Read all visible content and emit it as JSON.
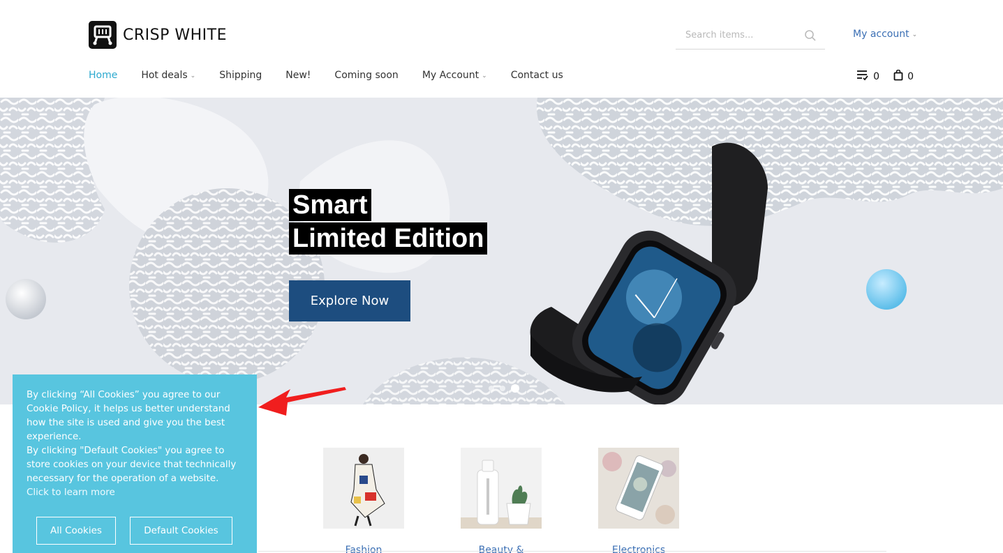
{
  "brand": {
    "name": "CRISP WHITE",
    "logo_icon": "cart-logo-icon"
  },
  "search": {
    "placeholder": "Search items...",
    "icon": "search-icon"
  },
  "account": {
    "label": "My account"
  },
  "nav": {
    "items": [
      {
        "label": "Home",
        "active": true,
        "dropdown": false
      },
      {
        "label": "Hot deals",
        "active": false,
        "dropdown": true
      },
      {
        "label": "Shipping",
        "active": false,
        "dropdown": false
      },
      {
        "label": "New!",
        "active": false,
        "dropdown": false
      },
      {
        "label": "Coming soon",
        "active": false,
        "dropdown": false
      },
      {
        "label": "My Account",
        "active": false,
        "dropdown": true
      },
      {
        "label": "Contact us",
        "active": false,
        "dropdown": false
      }
    ]
  },
  "header_icons": {
    "wishlist_count": "0",
    "cart_count": "0"
  },
  "hero": {
    "title_line1": "Smart",
    "title_line2": "Limited Edition",
    "cta_label": "Explore Now",
    "slides": 3,
    "active_slide": 3
  },
  "categories": [
    {
      "label": "Fashion"
    },
    {
      "label": "Beauty &"
    },
    {
      "label": "Electronics"
    }
  ],
  "cookie": {
    "text_1": "By clicking “All Cookies” you agree to our Cookie Policy, it helps us better understand how the site is used and give you the best experience.",
    "text_2": "By clicking \"Default Cookies\" you agree to store cookies on your device that technically necessary for the operation of a website.",
    "learn_more": "Click to learn more",
    "all_label": "All Cookies",
    "default_label": "Default Cookies"
  },
  "colors": {
    "accent": "#2ca9cf",
    "link": "#3b6fb4",
    "cta": "#1d4d7f",
    "cookie_bg": "#58c5df",
    "annotation_arrow": "#f01e1e"
  }
}
